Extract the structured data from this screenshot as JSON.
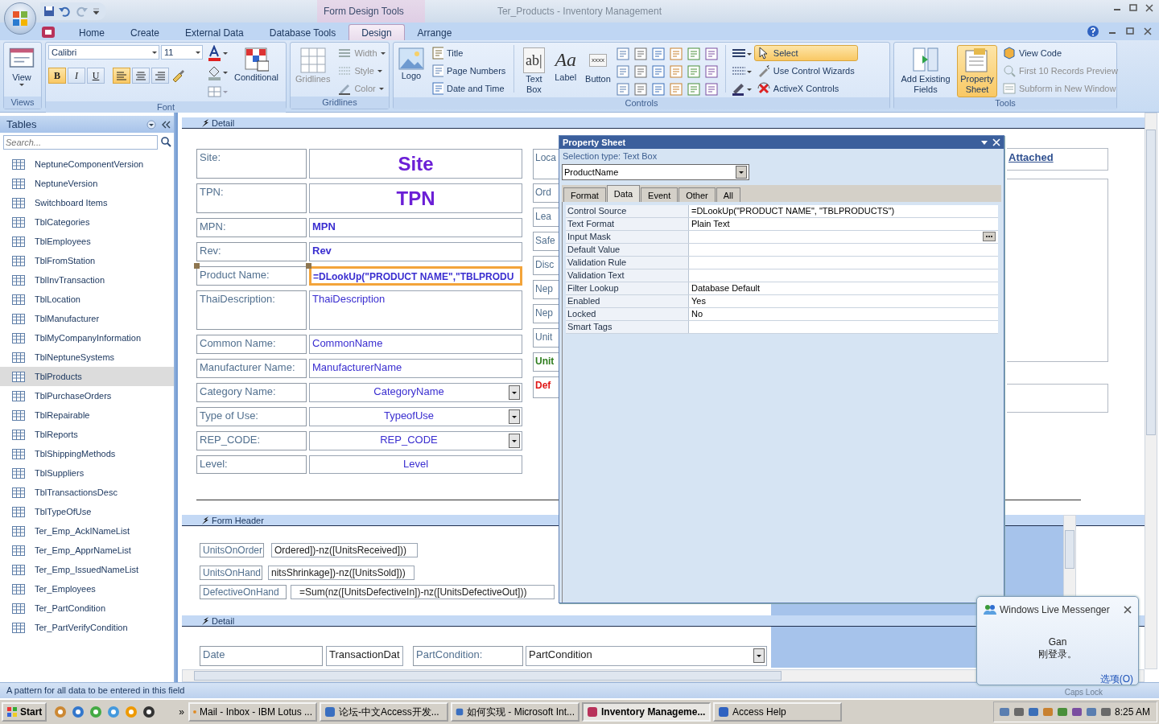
{
  "window": {
    "title": "Ter_Products - Inventory Management",
    "context_tab": "Form Design Tools"
  },
  "ribbon_tabs": [
    {
      "label": "Home",
      "selected": false
    },
    {
      "label": "Create",
      "selected": false
    },
    {
      "label": "External Data",
      "selected": false
    },
    {
      "label": "Database Tools",
      "selected": false
    },
    {
      "label": "Design",
      "selected": true
    },
    {
      "label": "Arrange",
      "selected": false
    }
  ],
  "ribbon_groups": [
    {
      "kind": "views",
      "label": "Views",
      "button": "View"
    },
    {
      "kind": "font",
      "label": "Font",
      "font_name": "Calibri",
      "font_size": "11",
      "styles": [
        {
          "label": "B",
          "selected": true
        },
        {
          "label": "I",
          "selected": false
        },
        {
          "label": "U",
          "selected": false
        }
      ],
      "aligns": [
        {
          "selected": true
        },
        {
          "selected": false
        },
        {
          "selected": false
        }
      ],
      "conditional": "Conditional"
    },
    {
      "kind": "gridlines",
      "label": "Gridlines",
      "large": {
        "label": "Gridlines",
        "disabled": true
      },
      "items": [
        {
          "label": "Width",
          "disabled": true
        },
        {
          "label": "Style",
          "disabled": true
        },
        {
          "label": "Color",
          "disabled": true
        }
      ]
    },
    {
      "kind": "controls",
      "label": "Controls",
      "logo": "Logo",
      "small": [
        {
          "label": "Title"
        },
        {
          "label": "Page Numbers"
        },
        {
          "label": "Date and Time"
        }
      ],
      "large": [
        {
          "label": "Text Box",
          "glyph": "ab|"
        },
        {
          "label": "Label",
          "glyph": "Aa"
        },
        {
          "label": "Button",
          "glyph": "xxxx"
        }
      ],
      "tools": [
        {
          "label": "Select",
          "selected": true
        },
        {
          "label": "Use Control Wizards",
          "selected": false
        },
        {
          "label": "ActiveX Controls",
          "selected": false
        }
      ]
    },
    {
      "kind": "tools",
      "label": "Tools",
      "large": [
        {
          "label": "Add Existing Fields",
          "selected": false
        },
        {
          "label": "Property Sheet",
          "selected": true
        }
      ],
      "small": [
        {
          "label": "View Code",
          "disabled": false
        },
        {
          "label": "First 10 Records Preview",
          "disabled": true
        },
        {
          "label": "Subform in New Window",
          "disabled": true
        }
      ]
    }
  ],
  "navigation_pane": {
    "title": "Tables",
    "search_placeholder": "Search...",
    "items": [
      {
        "label": "NeptuneComponentVersion",
        "selected": false
      },
      {
        "label": "NeptuneVersion",
        "selected": false
      },
      {
        "label": "Switchboard Items",
        "selected": false
      },
      {
        "label": "TblCategories",
        "selected": false
      },
      {
        "label": "TblEmployees",
        "selected": false
      },
      {
        "label": "TblFromStation",
        "selected": false
      },
      {
        "label": "TblInvTransaction",
        "selected": false
      },
      {
        "label": "TblLocation",
        "selected": false
      },
      {
        "label": "TblManufacturer",
        "selected": false
      },
      {
        "label": "TblMyCompanyInformation",
        "selected": false
      },
      {
        "label": "TblNeptuneSystems",
        "selected": false
      },
      {
        "label": "TblProducts",
        "selected": true
      },
      {
        "label": "TblPurchaseOrders",
        "selected": false
      },
      {
        "label": "TblRepairable",
        "selected": false
      },
      {
        "label": "TblReports",
        "selected": false
      },
      {
        "label": "TblShippingMethods",
        "selected": false
      },
      {
        "label": "TblSuppliers",
        "selected": false
      },
      {
        "label": "TblTransactionsDesc",
        "selected": false
      },
      {
        "label": "TblTypeOfUse",
        "selected": false
      },
      {
        "label": "Ter_Emp_AckINameList",
        "selected": false
      },
      {
        "label": "Ter_Emp_ApprNameList",
        "selected": false
      },
      {
        "label": "Ter_Emp_IssuedNameList",
        "selected": false
      },
      {
        "label": "Ter_Employees",
        "selected": false
      },
      {
        "label": "Ter_PartCondition",
        "selected": false
      },
      {
        "label": "Ter_PartVerifyCondition",
        "selected": false
      }
    ]
  },
  "form": {
    "detail": {
      "title": "Detail",
      "fields": [
        {
          "label": "Site:",
          "value": "Site",
          "kind": "title",
          "bold": true,
          "selected": false
        },
        {
          "label": "TPN:",
          "value": "TPN",
          "kind": "title",
          "bold": true,
          "selected": false
        },
        {
          "label": "MPN:",
          "value": "MPN",
          "kind": "text",
          "bold": true,
          "selected": false
        },
        {
          "label": "Rev:",
          "value": "Rev",
          "kind": "text",
          "bold": true,
          "selected": false
        },
        {
          "label": "Product Name:",
          "value": "=DLookUp(\"PRODUCT NAME\",\"TBLPRODU",
          "kind": "text",
          "bold": true,
          "selected": true
        },
        {
          "label": "ThaiDescription:",
          "value": "ThaiDescription",
          "kind": "multiline",
          "bold": false,
          "selected": false
        },
        {
          "label": "Common Name:",
          "value": "CommonName",
          "kind": "text",
          "bold": false,
          "selected": false
        },
        {
          "label": "Manufacturer Name:",
          "value": "ManufacturerName",
          "kind": "text",
          "bold": false,
          "selected": false
        },
        {
          "label": "Category Name:",
          "value": "CategoryName",
          "kind": "combo",
          "bold": false,
          "selected": false
        },
        {
          "label": "Type of Use:",
          "value": "TypeofUse",
          "kind": "combo",
          "bold": false,
          "selected": false
        },
        {
          "label": "REP_CODE:",
          "value": "REP_CODE",
          "kind": "combo",
          "bold": false,
          "selected": false
        },
        {
          "label": "Level:",
          "value": "Level",
          "kind": "centered",
          "bold": false,
          "selected": false
        }
      ],
      "side_labels": [
        {
          "text": "Loca",
          "color": "#52708f"
        },
        {
          "text": "Ord",
          "color": "#52708f"
        },
        {
          "text": "Lea",
          "color": "#52708f"
        },
        {
          "text": "Safe",
          "color": "#52708f"
        },
        {
          "text": "Disc",
          "color": "#52708f"
        },
        {
          "text": "Nep",
          "color": "#52708f"
        },
        {
          "text": "Nep",
          "color": "#52708f"
        },
        {
          "text": "Unit",
          "color": "#52708f"
        },
        {
          "text": "Unit",
          "color": "#2e7d1e"
        },
        {
          "text": "Def",
          "color": "#e01818"
        }
      ],
      "attached": "Attached"
    },
    "header": {
      "title": "Form Header",
      "rows": [
        {
          "label": "UnitsOnOrder",
          "value": "Ordered])-nz([UnitsReceived]))"
        },
        {
          "label": "UnitsOnHand",
          "value": "nitsShrinkage])-nz([UnitsSold]))"
        },
        {
          "label": "DefectiveOnHand",
          "value": "=Sum(nz([UnitsDefectiveIn])-nz([UnitsDefectiveOut]))"
        }
      ]
    },
    "detail2": {
      "title": "Detail",
      "controls": [
        {
          "kind": "label",
          "text": "Date"
        },
        {
          "kind": "text",
          "text": "TransactionDat"
        },
        {
          "kind": "label",
          "text": "PartCondition:"
        },
        {
          "kind": "combo",
          "text": "PartCondition"
        }
      ]
    }
  },
  "property_sheet": {
    "title": "Property Sheet",
    "selection_type": "Selection type:  Text Box",
    "object": "ProductName",
    "tabs": [
      {
        "label": "Format",
        "selected": false
      },
      {
        "label": "Data",
        "selected": true
      },
      {
        "label": "Event",
        "selected": false
      },
      {
        "label": "Other",
        "selected": false
      },
      {
        "label": "All",
        "selected": false
      }
    ],
    "rows": [
      {
        "name": "Control Source",
        "value": "=DLookUp(\"PRODUCT NAME\", \"TBLPRODUCTS\")",
        "builder": false
      },
      {
        "name": "Text Format",
        "value": "Plain Text",
        "builder": false
      },
      {
        "name": "Input Mask",
        "value": "",
        "builder": true
      },
      {
        "name": "Default Value",
        "value": "",
        "builder": false
      },
      {
        "name": "Validation Rule",
        "value": "",
        "builder": false
      },
      {
        "name": "Validation Text",
        "value": "",
        "builder": false
      },
      {
        "name": "Filter Lookup",
        "value": "Database Default",
        "builder": false
      },
      {
        "name": "Enabled",
        "value": "Yes",
        "builder": false
      },
      {
        "name": "Locked",
        "value": "No",
        "builder": false
      },
      {
        "name": "Smart Tags",
        "value": "",
        "builder": false
      }
    ]
  },
  "status_bar": {
    "text": "A pattern for all data to be entered in this field",
    "caps_lock": "Caps Lock"
  },
  "messenger_popup": {
    "title": "Windows Live Messenger",
    "name": "Gan",
    "message": "刚登录。",
    "options_link": "选项(O)"
  },
  "taskbar": {
    "start": "Start",
    "more": "»",
    "tasks": [
      {
        "label": "Mail - Inbox - IBM Lotus ...",
        "selected": false
      },
      {
        "label": "论坛-中文Access开发...",
        "selected": false
      },
      {
        "label": "如何实现 - Microsoft Int...",
        "selected": false
      },
      {
        "label": "Inventory Manageme...",
        "selected": true
      },
      {
        "label": "Access Help",
        "selected": false
      }
    ],
    "clock": "8:25 AM"
  }
}
